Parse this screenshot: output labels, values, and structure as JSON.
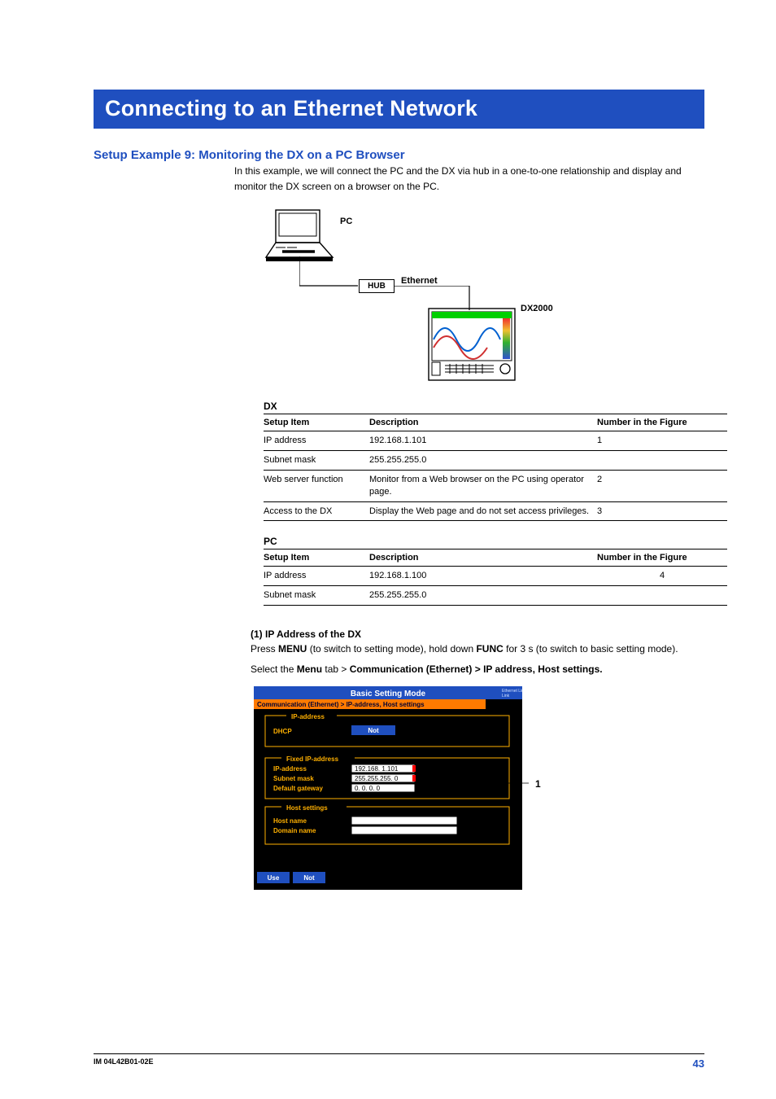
{
  "banner": "Connecting to an Ethernet Network",
  "setup_title": "Setup Example 9: Monitoring the DX on a PC Browser",
  "intro": "In this example, we will connect the PC and the DX via hub in a one-to-one relationship and display and monitor the DX screen on a browser on the PC.",
  "diagram": {
    "pc": "PC",
    "hub": "HUB",
    "ethernet": "Ethernet",
    "dx": "DX2000"
  },
  "table_dx": {
    "title": "DX",
    "headers": [
      "Setup Item",
      "Description",
      "Number in the Figure"
    ],
    "rows": [
      {
        "item": "IP address",
        "desc": "192.168.1.101",
        "num": "1"
      },
      {
        "item": "Subnet mask",
        "desc": "255.255.255.0",
        "num": ""
      },
      {
        "item": "Web server function",
        "desc": "Monitor from a Web browser on the PC using operator page.",
        "num": "2"
      },
      {
        "item": "Access to the DX",
        "desc": "Display the Web page and do not set access privileges.",
        "num": "3"
      }
    ]
  },
  "table_pc": {
    "title": "PC",
    "headers": [
      "Setup Item",
      "Description",
      "Number in the Figure"
    ],
    "rows": [
      {
        "item": "IP address",
        "desc": "192.168.1.100",
        "num": "4"
      },
      {
        "item": "Subnet mask",
        "desc": "255.255.255.0",
        "num": ""
      }
    ]
  },
  "section1": {
    "title": "(1) IP Address of the DX",
    "line1a": "Press ",
    "line1b": "MENU",
    "line1c": " (to switch to setting mode), hold down ",
    "line1d": "FUNC",
    "line1e": " for 3 s (to switch to basic setting mode).",
    "line2a": "Select the ",
    "line2b": "Menu",
    "line2c": " tab > ",
    "line2d": "Communication (Ethernet) > IP address, Host settings."
  },
  "dxscreen": {
    "header": "Basic Setting Mode",
    "ethlink": "Ethernet\nLink",
    "breadcrumb": "Communication (Ethernet) > IP-address, Host settings",
    "grp_ip": "IP-address",
    "dhcp": "DHCP",
    "not": "Not",
    "grp_fixed": "Fixed IP-address",
    "ip_lbl": "IP-address",
    "ip_val": "192.168.  1.101",
    "sub_lbl": "Subnet mask",
    "sub_val": "255.255.255.  0",
    "gw_lbl": "Default gateway",
    "gw_val": "  0.  0.  0.  0",
    "grp_host": "Host settings",
    "host_lbl": "Host name",
    "domain_lbl": "Domain name",
    "btn_use": "Use",
    "btn_not": "Not",
    "callout1": "1"
  },
  "footer": {
    "left": "IM 04L42B01-02E",
    "right": "43"
  }
}
